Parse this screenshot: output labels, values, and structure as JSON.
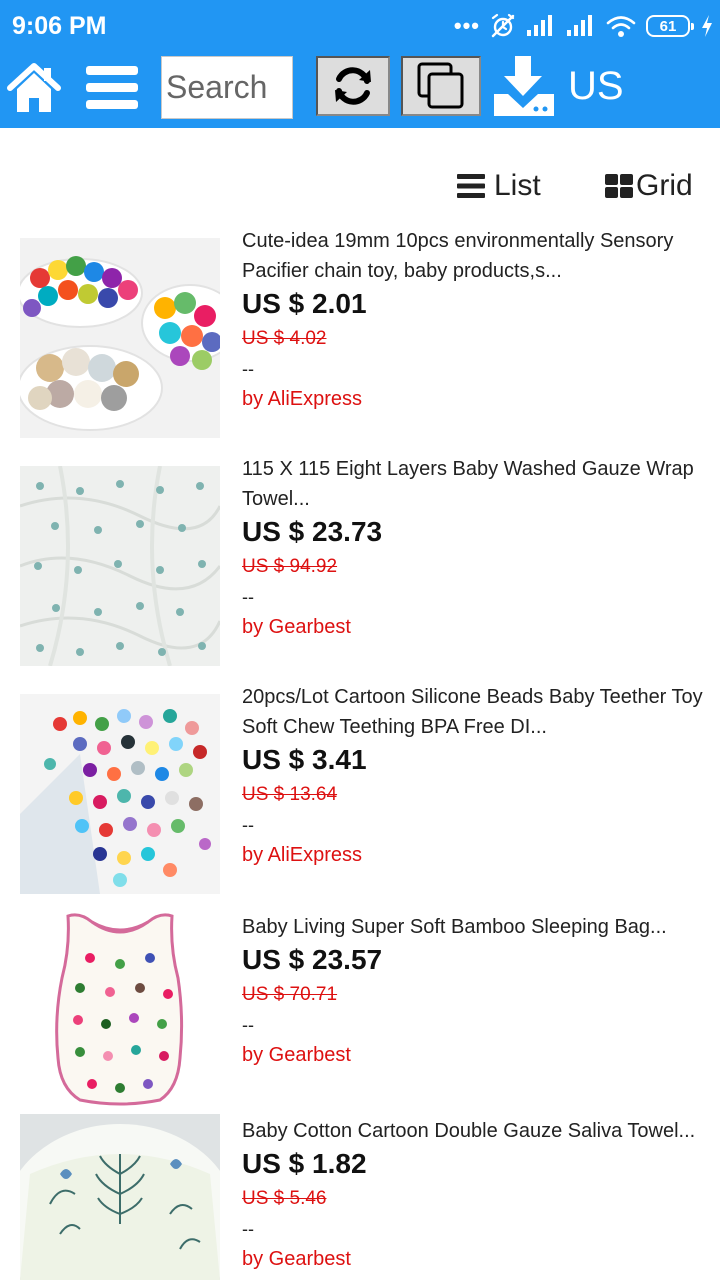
{
  "status_bar": {
    "time": "9:06 PM",
    "battery": "61"
  },
  "toolbar": {
    "search_placeholder": "Search",
    "region": "US"
  },
  "view_toggle": {
    "list_label": "List",
    "grid_label": "Grid"
  },
  "products": [
    {
      "title": "Cute-idea 19mm 10pcs environmentally Sensory Pacifier chain toy, baby products,s...",
      "price": "US $ 2.01",
      "old_price": "US $ 4.02",
      "dash": "--",
      "seller": "by AliExpress"
    },
    {
      "title": "115 X 115 Eight Layers Baby Washed Gauze Wrap Towel...",
      "price": "US $ 23.73",
      "old_price": "US $ 94.92",
      "dash": "--",
      "seller": "by Gearbest"
    },
    {
      "title": "20pcs/Lot Cartoon Silicone Beads Baby Teether Toy Soft Chew Teething BPA Free DI...",
      "price": "US $ 3.41",
      "old_price": "US $ 13.64",
      "dash": "--",
      "seller": "by AliExpress"
    },
    {
      "title": "Baby Living Super Soft Bamboo Sleeping Bag...",
      "price": "US $ 23.57",
      "old_price": "US $ 70.71",
      "dash": "--",
      "seller": "by Gearbest"
    },
    {
      "title": "Baby Cotton Cartoon Double Gauze Saliva Towel...",
      "price": "US $ 1.82",
      "old_price": "US $ 5.46",
      "dash": "--",
      "seller": "by Gearbest"
    }
  ],
  "colors": {
    "header_blue": "#2196f3",
    "price_red": "#dd1111"
  }
}
